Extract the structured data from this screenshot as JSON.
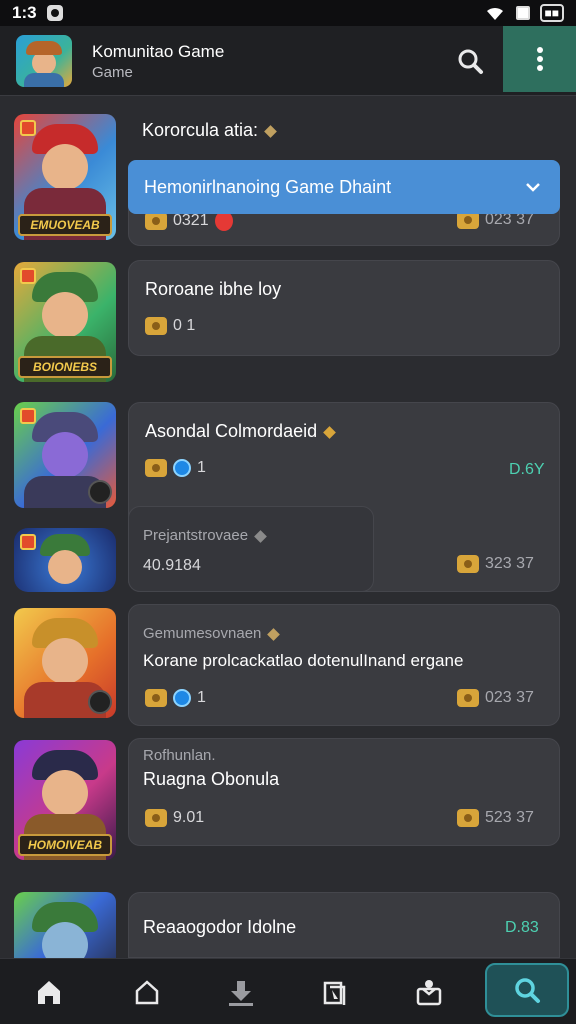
{
  "status": {
    "time": "1:3"
  },
  "header": {
    "title": "Komunitao Game",
    "subtitle": "Game"
  },
  "section": {
    "title": "Kororcula atia:"
  },
  "dropdown": {
    "label": "Hemonirlnanoing Game Dhaint"
  },
  "items": [
    {
      "banner": "EMUOVEAB",
      "meta_left": "0321",
      "meta_right": "023 37"
    },
    {
      "title": "Rorоane ibhe loy",
      "banner": "BOIONEBS",
      "meta_left": "0 1"
    },
    {
      "title": "Asondal Colmordaeid",
      "meta_left": "1",
      "meta_right": "D.6Y"
    },
    {
      "subtitle": "Prejantstrovaee",
      "value": "40.9184",
      "meta_right": "323 37"
    },
    {
      "subtitle": "Gemumesovnaen",
      "title": "Korane prolcackatlao dotenulInand ergane",
      "meta_left": "1",
      "meta_right": "023 37"
    },
    {
      "subtitle": "Rofhunlan.",
      "title": "Ruagna Obonula",
      "banner": "HOMOIVEAB",
      "meta_left": "9.01",
      "meta_right": "523 37"
    },
    {
      "title": "Reaaogodor Idolne",
      "meta_right": "D.83"
    }
  ],
  "colors": {
    "accent_blue": "#4a8fd6",
    "accent_teal": "#4dd0b1",
    "card": "#3a3b40"
  }
}
